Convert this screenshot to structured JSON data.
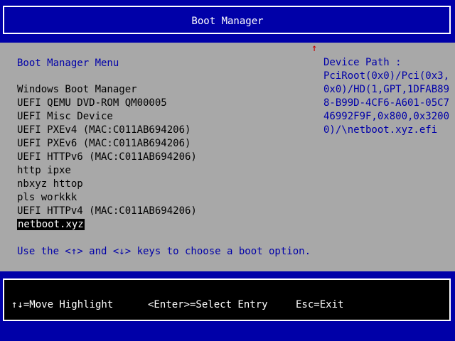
{
  "header": {
    "title": "Boot Manager"
  },
  "main": {
    "scroll_indicator": "↑",
    "menu_title": "Boot Manager Menu",
    "items": [
      "Windows Boot Manager",
      "UEFI QEMU DVD-ROM QM00005",
      "UEFI Misc Device",
      "UEFI PXEv4 (MAC:C011AB694206)",
      "UEFI PXEv6 (MAC:C011AB694206)",
      "UEFI HTTPv6 (MAC:C011AB694206)",
      "http ipxe",
      "nbxyz httop",
      "pls workkk",
      "UEFI HTTPv4 (MAC:C011AB694206)",
      "netboot.xyz"
    ],
    "selected_index": 10,
    "hint": "Use the <↑> and <↓> keys to choose a boot option."
  },
  "device_path": {
    "label": "Device Path :",
    "value": "PciRoot(0x0)/Pci(0x3,0x0)/HD(1,GPT,1DFAB898-B99D-4CF6-A601-05C746992F9F,0x800,0x32000)/\\netboot.xyz.efi"
  },
  "footer": {
    "move": "↑↓=Move Highlight",
    "select": "<Enter>=Select Entry",
    "exit": "Esc=Exit"
  },
  "colors": {
    "frame_blue": "#0000a8",
    "panel_gray": "#a8a8a8",
    "accent_text": "#0000a8",
    "scroll_arrow": "#c80000"
  }
}
